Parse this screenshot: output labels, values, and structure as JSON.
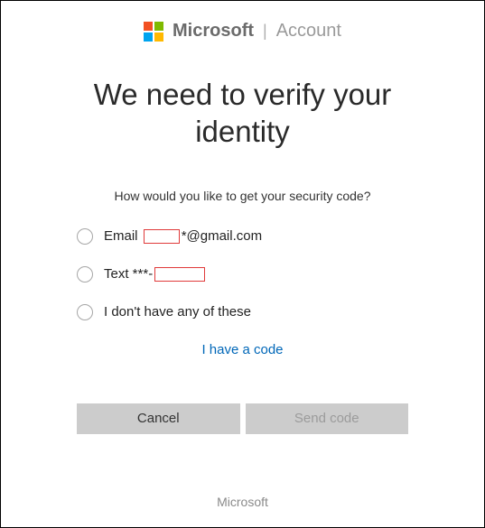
{
  "header": {
    "brand": "Microsoft",
    "section": "Account"
  },
  "title": "We need to verify your identity",
  "prompt": "How would you like to get your security code?",
  "options": {
    "email_prefix": "Email ",
    "email_suffix": "*@gmail.com",
    "text_prefix": "Text ***-",
    "none": "I don't have any of these"
  },
  "have_code": "I have a code",
  "buttons": {
    "cancel": "Cancel",
    "send": "Send code"
  },
  "footer": "Microsoft"
}
